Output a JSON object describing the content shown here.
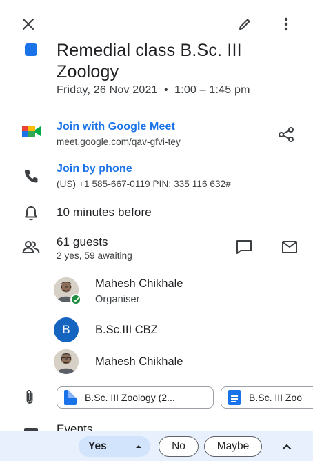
{
  "header": {
    "close_icon": "close-icon",
    "edit_icon": "pencil-icon",
    "menu_icon": "more-vert-icon"
  },
  "event": {
    "color": "#1a73e8",
    "title": "Remedial class B.Sc. III Zoology",
    "datetime": "Friday, 26 Nov 2021  •  1:00 – 1:45 pm"
  },
  "meet": {
    "label": "Join with Google Meet",
    "url": "meet.google.com/qav-gfvi-tey"
  },
  "phone": {
    "label": "Join by phone",
    "details": "(US) +1 585-667-0119 PIN: 335 116 632#"
  },
  "reminder": {
    "text": "10 minutes before"
  },
  "guests": {
    "count": "61 guests",
    "summary": "2 yes, 59 awaiting",
    "list": [
      {
        "name": "Mahesh Chikhale",
        "role": "Organiser"
      },
      {
        "name": "B.Sc.III CBZ",
        "initial": "B"
      },
      {
        "name": "Mahesh Chikhale"
      }
    ]
  },
  "attachments": [
    {
      "label": "B.Sc. III Zoology  (2..."
    },
    {
      "label": "B.Sc. III Zoo"
    }
  ],
  "events": {
    "label": "Events"
  },
  "rsvp": {
    "yes": "Yes",
    "no": "No",
    "maybe": "Maybe"
  },
  "colors": {
    "accent": "#1a73e8",
    "rsvp_selected": "#d2e3fc",
    "avatar_b": "#1565c0"
  }
}
